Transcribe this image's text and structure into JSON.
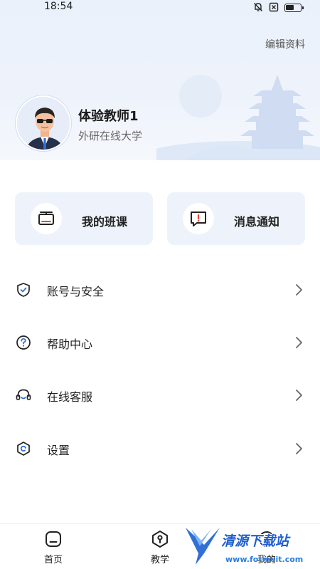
{
  "status_bar": {
    "time": "18:54",
    "icons": [
      "bell-off-icon",
      "sim-x-icon",
      "battery-icon"
    ]
  },
  "profile": {
    "edit_label": "编辑资料",
    "name": "体验教师1",
    "school": "外研在线大学"
  },
  "quick_actions": [
    {
      "label": "我的班课",
      "icon": "class-screen-icon"
    },
    {
      "label": "消息通知",
      "icon": "message-alert-icon"
    }
  ],
  "menu": [
    {
      "label": "账号与安全",
      "icon": "shield-check-icon"
    },
    {
      "label": "帮助中心",
      "icon": "help-circle-icon"
    },
    {
      "label": "在线客服",
      "icon": "headset-icon"
    },
    {
      "label": "设置",
      "icon": "settings-hex-icon"
    }
  ],
  "tabs": [
    {
      "label": "首页",
      "icon": "home-icon"
    },
    {
      "label": "教学",
      "icon": "teach-icon"
    },
    {
      "label": "我的",
      "icon": "profile-icon"
    }
  ],
  "watermark": {
    "text": "清源下载站",
    "url": "www.fotmeit.com"
  },
  "colors": {
    "accent": "#1d5fd1",
    "card_bg": "#eef3fb",
    "header_bg": "#eaf1fb",
    "alert_red": "#e8453c"
  }
}
